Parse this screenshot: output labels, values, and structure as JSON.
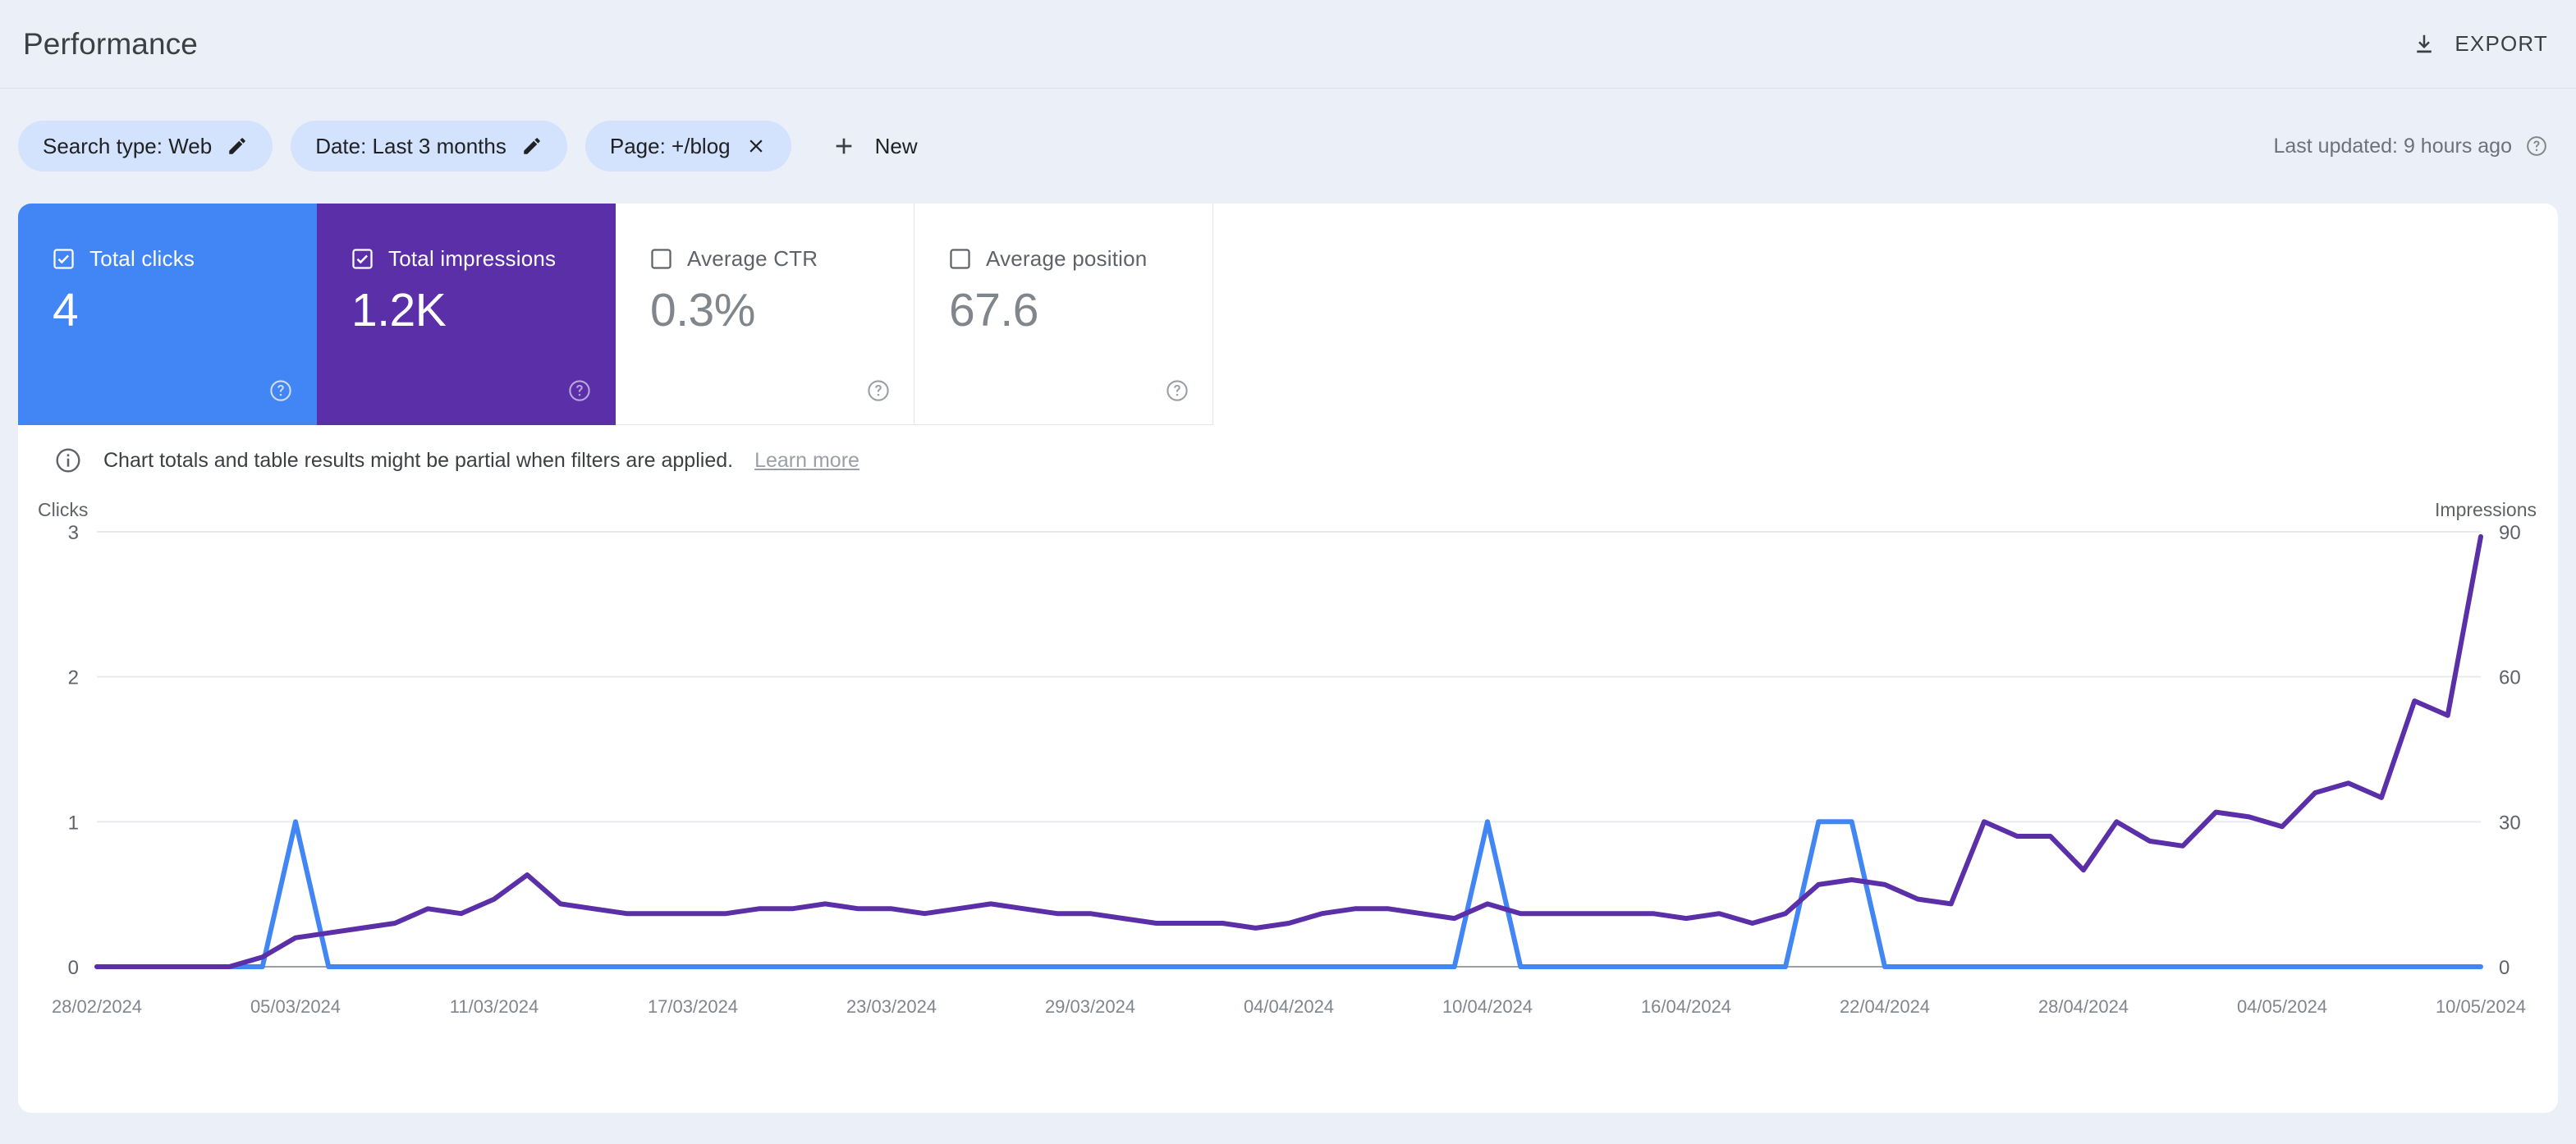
{
  "header": {
    "title": "Performance",
    "export_label": "EXPORT",
    "export_icon": "download-icon"
  },
  "filters": {
    "chips": [
      {
        "label": "Search type: Web",
        "icon": "pencil-icon",
        "action": "edit"
      },
      {
        "label": "Date: Last 3 months",
        "icon": "pencil-icon",
        "action": "edit"
      },
      {
        "label": "Page: +/blog",
        "icon": "close-icon",
        "action": "remove"
      }
    ],
    "new_label": "New",
    "new_icon": "plus-icon",
    "last_updated": "Last updated: 9 hours ago",
    "help_icon": "help-circle-icon"
  },
  "metrics": [
    {
      "label": "Total clicks",
      "value": "4",
      "checked": true,
      "state": "selected-blue",
      "color": "#4285f4"
    },
    {
      "label": "Total impressions",
      "value": "1.2K",
      "checked": true,
      "state": "selected-purple",
      "color": "#5a2fa8"
    },
    {
      "label": "Average CTR",
      "value": "0.3%",
      "checked": false,
      "state": "idle",
      "color": "#5f6368"
    },
    {
      "label": "Average position",
      "value": "67.6",
      "checked": false,
      "state": "idle",
      "color": "#5f6368"
    }
  ],
  "banner": {
    "icon": "info-icon",
    "text": "Chart totals and table results might be partial when filters are applied.",
    "link_label": "Learn more"
  },
  "chart_data": {
    "type": "line",
    "title": "",
    "left_axis_label": "Clicks",
    "right_axis_label": "Impressions",
    "left_ticks": [
      0,
      1,
      2,
      3
    ],
    "right_ticks": [
      0,
      30,
      60,
      90
    ],
    "left_ylim": [
      0,
      3
    ],
    "right_ylim": [
      0,
      90
    ],
    "grid": true,
    "legend": "none",
    "x_tick_labels": [
      "28/02/2024",
      "05/03/2024",
      "11/03/2024",
      "17/03/2024",
      "23/03/2024",
      "29/03/2024",
      "04/04/2024",
      "10/04/2024",
      "16/04/2024",
      "22/04/2024",
      "28/04/2024",
      "04/05/2024",
      "10/05/2024"
    ],
    "x_tick_indices": [
      0,
      6,
      12,
      18,
      24,
      30,
      36,
      42,
      48,
      54,
      60,
      66,
      72
    ],
    "x": [
      "28/02/2024",
      "29/02/2024",
      "01/03/2024",
      "02/03/2024",
      "03/03/2024",
      "04/03/2024",
      "05/03/2024",
      "06/03/2024",
      "07/03/2024",
      "08/03/2024",
      "09/03/2024",
      "10/03/2024",
      "11/03/2024",
      "12/03/2024",
      "13/03/2024",
      "14/03/2024",
      "15/03/2024",
      "16/03/2024",
      "17/03/2024",
      "18/03/2024",
      "19/03/2024",
      "20/03/2024",
      "21/03/2024",
      "22/03/2024",
      "23/03/2024",
      "24/03/2024",
      "25/03/2024",
      "26/03/2024",
      "27/03/2024",
      "28/03/2024",
      "29/03/2024",
      "30/03/2024",
      "31/03/2024",
      "01/04/2024",
      "02/04/2024",
      "03/04/2024",
      "04/04/2024",
      "05/04/2024",
      "06/04/2024",
      "07/04/2024",
      "08/04/2024",
      "09/04/2024",
      "10/04/2024",
      "11/04/2024",
      "12/04/2024",
      "13/04/2024",
      "14/04/2024",
      "15/04/2024",
      "16/04/2024",
      "17/04/2024",
      "18/04/2024",
      "19/04/2024",
      "20/04/2024",
      "21/04/2024",
      "22/04/2024",
      "23/04/2024",
      "24/04/2024",
      "25/04/2024",
      "26/04/2024",
      "27/04/2024",
      "28/04/2024",
      "29/04/2024",
      "30/04/2024",
      "01/05/2024",
      "02/05/2024",
      "03/05/2024",
      "04/05/2024",
      "05/05/2024",
      "06/05/2024",
      "07/05/2024",
      "08/05/2024",
      "09/05/2024",
      "10/05/2024"
    ],
    "series": [
      {
        "name": "Clicks",
        "axis": "left",
        "color": "#4285f4",
        "values": [
          0,
          0,
          0,
          0,
          0,
          0,
          1,
          0,
          0,
          0,
          0,
          0,
          0,
          0,
          0,
          0,
          0,
          0,
          0,
          0,
          0,
          0,
          0,
          0,
          0,
          0,
          0,
          0,
          0,
          0,
          0,
          0,
          0,
          0,
          0,
          0,
          0,
          0,
          0,
          0,
          0,
          0,
          1,
          0,
          0,
          0,
          0,
          0,
          0,
          0,
          0,
          0,
          1,
          1,
          0,
          0,
          0,
          0,
          0,
          0,
          0,
          0,
          0,
          0,
          0,
          0,
          0,
          0,
          0,
          0,
          0,
          0,
          0
        ]
      },
      {
        "name": "Impressions",
        "axis": "right",
        "color": "#5a2fa8",
        "values": [
          0,
          0,
          0,
          0,
          0,
          2,
          6,
          7,
          8,
          9,
          12,
          11,
          14,
          19,
          13,
          12,
          11,
          11,
          11,
          11,
          12,
          12,
          13,
          12,
          12,
          11,
          12,
          13,
          12,
          11,
          11,
          10,
          9,
          9,
          9,
          8,
          9,
          11,
          12,
          12,
          11,
          10,
          13,
          11,
          11,
          11,
          11,
          11,
          10,
          11,
          9,
          11,
          17,
          18,
          17,
          14,
          13,
          30,
          27,
          27,
          20,
          30,
          26,
          25,
          32,
          31,
          29,
          36,
          38,
          35,
          55,
          52,
          89
        ]
      }
    ]
  }
}
